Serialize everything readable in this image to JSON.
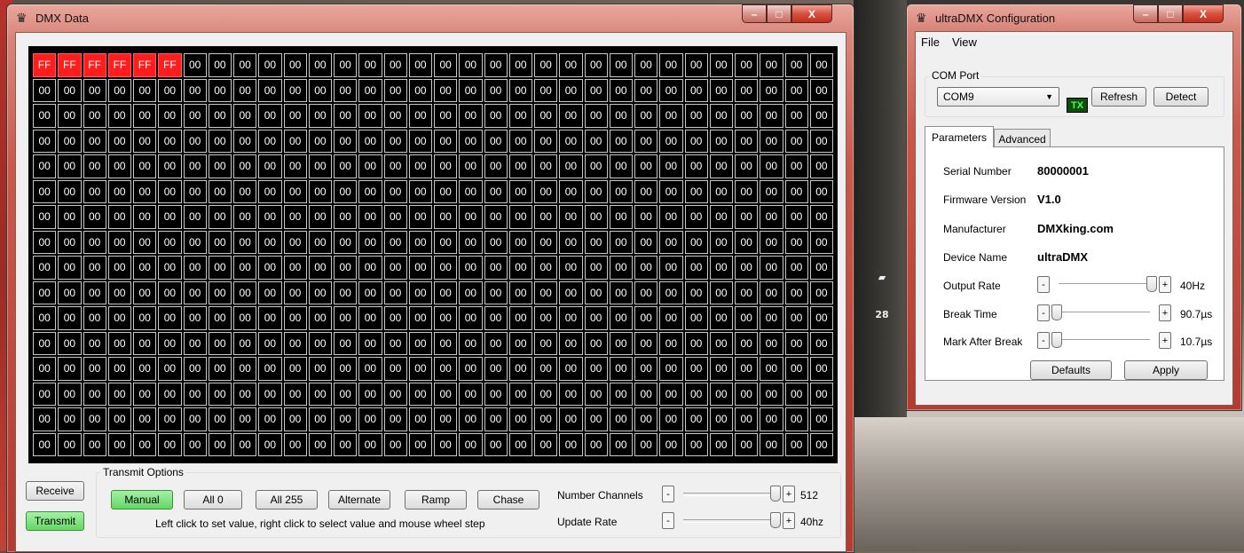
{
  "dmx_window": {
    "title": "DMX Data",
    "grid": {
      "rows": 16,
      "columns": 32,
      "first_row_values": [
        "FF",
        "FF",
        "FF",
        "FF",
        "FF",
        "FF",
        "00",
        "00",
        "00",
        "00",
        "00",
        "00",
        "00",
        "00",
        "00",
        "00",
        "00",
        "00",
        "00",
        "00",
        "00",
        "00",
        "00",
        "00",
        "00",
        "00",
        "00",
        "00",
        "00",
        "00",
        "00",
        "00"
      ],
      "default_value": "00",
      "highlight_color": "#ff1d1d"
    },
    "receive_label": "Receive",
    "transmit_label": "Transmit",
    "transmit_options": {
      "group_label": "Transmit Options",
      "manual_label": "Manual",
      "all0_label": "All 0",
      "all255_label": "All 255",
      "alternate_label": "Alternate",
      "ramp_label": "Ramp",
      "chase_label": "Chase",
      "hint": "Left click to set value, right click to select value and mouse wheel step"
    },
    "number_channels": {
      "label": "Number Channels",
      "value": "512",
      "level": 1.0
    },
    "update_rate": {
      "label": "Update Rate",
      "value": "40hz",
      "level": 1.0
    }
  },
  "config_window": {
    "title": "ultraDMX Configuration",
    "menu": [
      "File",
      "View"
    ],
    "com_port": {
      "group_label": "COM Port",
      "selected": "COM9",
      "tx_label": "TX",
      "refresh_label": "Refresh",
      "detect_label": "Detect"
    },
    "tabs": [
      "Parameters",
      "Advanced"
    ],
    "parameters": {
      "serial_label": "Serial Number",
      "serial_value": "80000001",
      "firmware_label": "Firmware Version",
      "firmware_value": "V1.0",
      "manufacturer_label": "Manufacturer",
      "manufacturer_value": "DMXking.com",
      "device_label": "Device Name",
      "device_value": "ultraDMX",
      "output_rate": {
        "label": "Output Rate",
        "value": "40Hz",
        "level": 1.0
      },
      "break_time": {
        "label": "Break Time",
        "value": "90.7µs",
        "level": 0.0
      },
      "mark_after_break": {
        "label": "Mark After Break",
        "value": "10.7µs",
        "level": 0.0
      },
      "defaults_label": "Defaults",
      "apply_label": "Apply"
    }
  },
  "window_controls": {
    "minimize": "–",
    "maximize": "□",
    "close": "X"
  },
  "background_badge": "28"
}
